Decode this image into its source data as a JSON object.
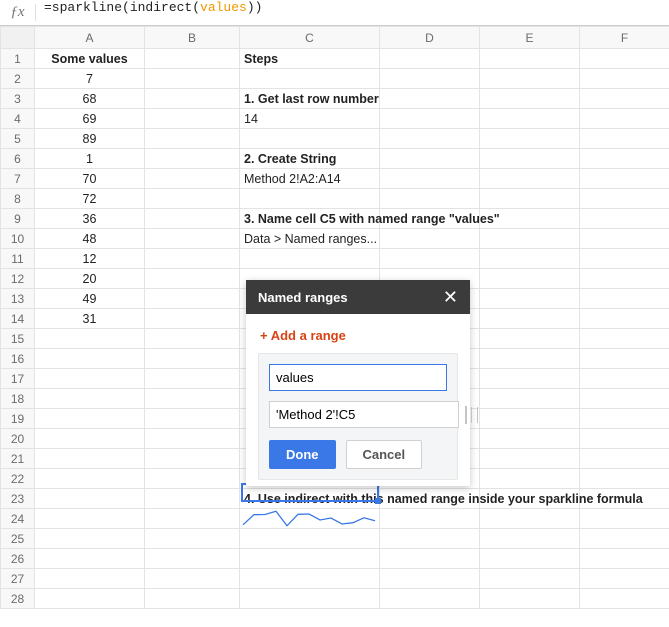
{
  "formula": {
    "prefix": "=sparkline(indirect(",
    "named": "values",
    "suffix": "))"
  },
  "columns": [
    "A",
    "B",
    "C",
    "D",
    "E",
    "F"
  ],
  "row_count": 28,
  "active_row": 24,
  "colA_header": "Some values",
  "colA_values": [
    7,
    68,
    69,
    89,
    1,
    70,
    72,
    36,
    48,
    12,
    20,
    49,
    31
  ],
  "colC": {
    "r1": "Steps",
    "r3": "1. Get last row number",
    "r4": "14",
    "r6": "2. Create String",
    "r7": "Method 2!A2:A14",
    "r9": "3. Name cell C5 with named range \"values\"",
    "r10": "Data > Named ranges...",
    "r23": "4. Use indirect with this named range inside your sparkline formula"
  },
  "panel": {
    "title": "Named ranges",
    "close": "✕",
    "add_range": "+ Add a range",
    "name_value": "values",
    "ref_value": "'Method 2'!C5",
    "done": "Done",
    "cancel": "Cancel"
  },
  "chart_data": {
    "type": "line",
    "title": "",
    "xlabel": "",
    "ylabel": "",
    "categories": [
      1,
      2,
      3,
      4,
      5,
      6,
      7,
      8,
      9,
      10,
      11,
      12,
      13
    ],
    "values": [
      7,
      68,
      69,
      89,
      1,
      70,
      72,
      36,
      48,
      12,
      20,
      49,
      31
    ],
    "ylim": [
      0,
      90
    ]
  }
}
